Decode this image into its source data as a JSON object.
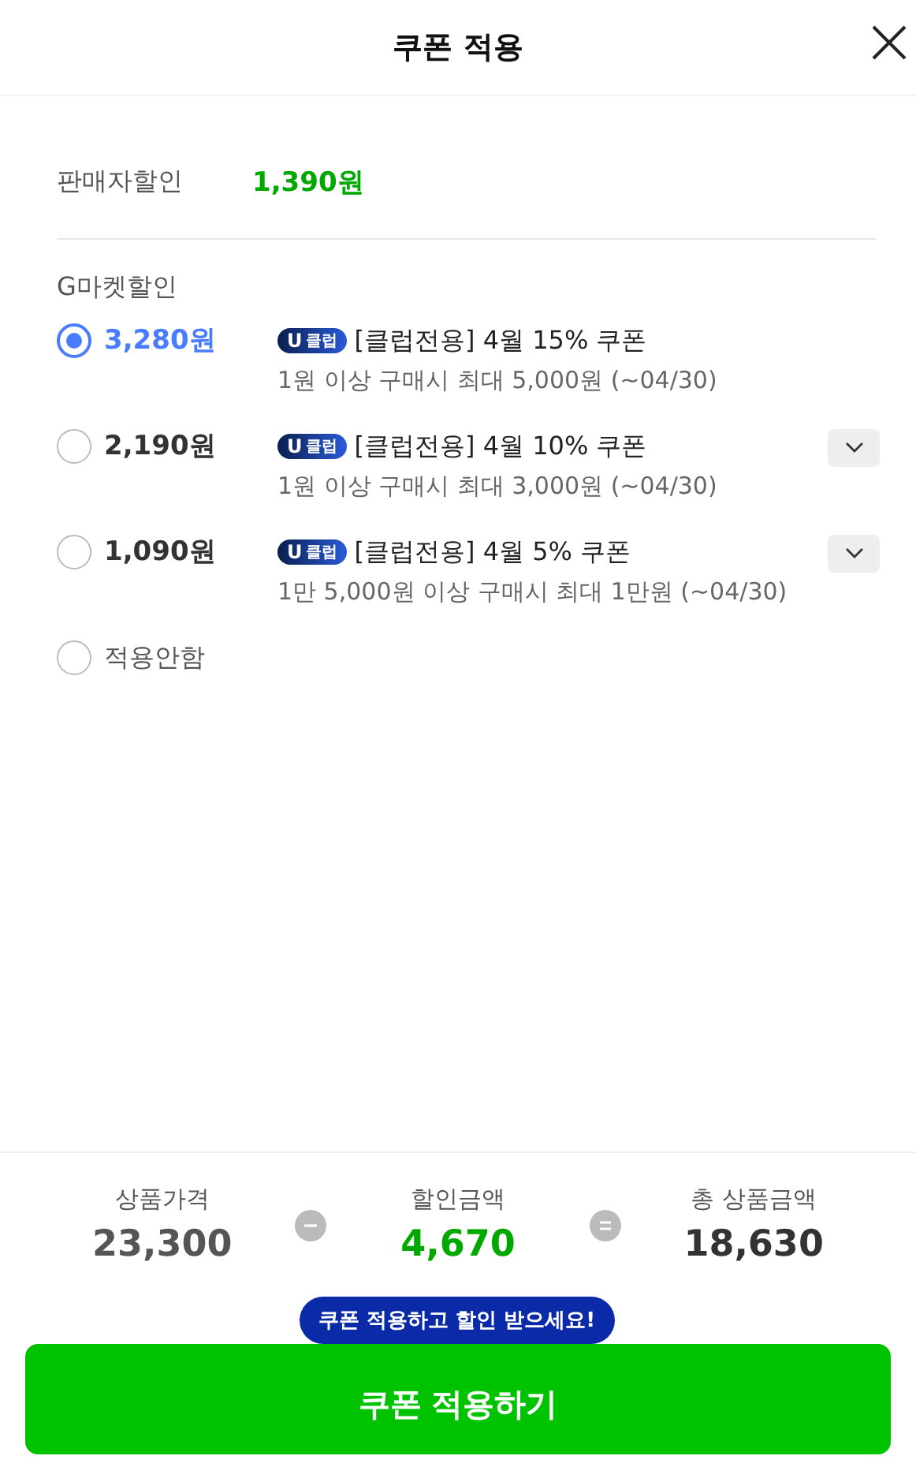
{
  "header": {
    "title": "쿠폰 적용"
  },
  "seller_discount": {
    "label": "판매자할인",
    "amount": "1,390원"
  },
  "gmarket_discount": {
    "label": "G마켓할인",
    "coupons": [
      {
        "amount": "3,280원",
        "badge_u": "U",
        "badge_text": "클럽",
        "title": "[클럽전용] 4월 15% 쿠폰",
        "condition": "1원 이상 구매시 최대 5,000원 (~04/30)",
        "selected": true,
        "expandable": false
      },
      {
        "amount": "2,190원",
        "badge_u": "U",
        "badge_text": "클럽",
        "title": "[클럽전용] 4월 10% 쿠폰",
        "condition": "1원 이상 구매시 최대 3,000원 (~04/30)",
        "selected": false,
        "expandable": true
      },
      {
        "amount": "1,090원",
        "badge_u": "U",
        "badge_text": "클럽",
        "title": "[클럽전용] 4월 5% 쿠폰",
        "condition": "1만 5,000원 이상 구매시 최대 1만원 (~04/30)",
        "selected": false,
        "expandable": true
      }
    ],
    "none_option": {
      "label": "적용안함",
      "selected": false
    }
  },
  "summary": [
    {
      "label": "상품가격",
      "value": "23,300",
      "kind": "price"
    },
    {
      "kind": "minus"
    },
    {
      "label": "할인금액",
      "value": "4,670",
      "kind": "discount"
    },
    {
      "kind": "equals"
    },
    {
      "label": "총 상품금액",
      "value": "18,630",
      "kind": "total"
    }
  ],
  "tooltip": "쿠폰 적용하고 할인 받으세요!",
  "apply_button": "쿠폰 적용하기"
}
